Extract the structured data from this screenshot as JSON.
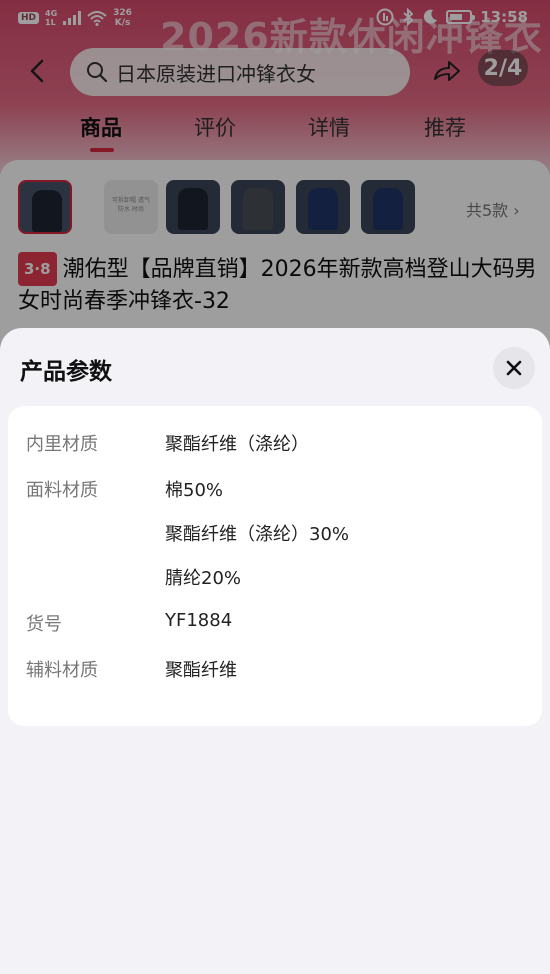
{
  "status_bar": {
    "hd": "HD",
    "network_top": "4G",
    "network_bottom": "1L",
    "speed_value": "326",
    "speed_unit": "K/s",
    "time": "13:58"
  },
  "background": {
    "hero_text": "2026新款休闲冲锋衣",
    "search_query": "日本原装进口冲锋衣女",
    "page_counter": "2/4",
    "tabs": [
      {
        "label": "商品",
        "active": true
      },
      {
        "label": "评价",
        "active": false
      },
      {
        "label": "详情",
        "active": false
      },
      {
        "label": "推荐",
        "active": false
      }
    ],
    "thumbnail_light_text": "可拆卸帽 透气防水 时尚",
    "total_styles": "共5款",
    "promo_badge": "3·8",
    "product_title": "潮佑型【品牌直销】2026年新款高档登山大码男女时尚春季冲锋衣-32"
  },
  "sheet": {
    "title": "产品参数",
    "params": [
      {
        "label": "内里材质",
        "value": "聚酯纤维（涤纶）"
      },
      {
        "label": "面料材质",
        "value": "棉50%"
      },
      {
        "label": "",
        "value": "聚酯纤维（涤纶）30%"
      },
      {
        "label": "",
        "value": "腈纶20%"
      },
      {
        "label": "货号",
        "value": "YF1884"
      },
      {
        "label": "辅料材质",
        "value": "聚酯纤维"
      }
    ]
  },
  "colors": {
    "accent": "#d8263f",
    "sheet_bg": "#f3f3f7",
    "card_bg": "#ffffff"
  }
}
